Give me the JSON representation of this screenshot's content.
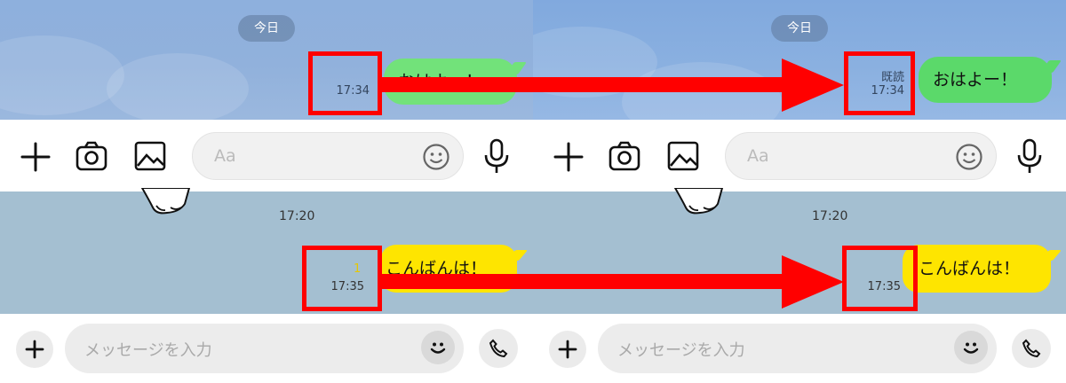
{
  "left": {
    "line": {
      "date_label": "今日",
      "message": "おはよー！",
      "time": "17:34",
      "read_label": "",
      "input_placeholder": "Aa"
    },
    "kakao": {
      "time_above": "17:20",
      "message": "こんばんは！",
      "unread_count": "1",
      "time": "17:35",
      "input_placeholder": "メッセージを入力"
    }
  },
  "right": {
    "line": {
      "date_label": "今日",
      "message": "おはよー！",
      "time": "17:34",
      "read_label": "既読",
      "input_placeholder": "Aa"
    },
    "kakao": {
      "time_above": "17:20",
      "message": "こんばんは！",
      "unread_count": "",
      "time": "17:35",
      "input_placeholder": "メッセージを入力"
    }
  },
  "colors": {
    "line_bubble": "#72e27a",
    "kakao_bubble": "#fee500",
    "highlight": "#ff0000"
  },
  "icons": [
    "plus-icon",
    "camera-icon",
    "image-icon",
    "emoji-icon",
    "microphone-icon",
    "call-icon",
    "sticker-character"
  ]
}
